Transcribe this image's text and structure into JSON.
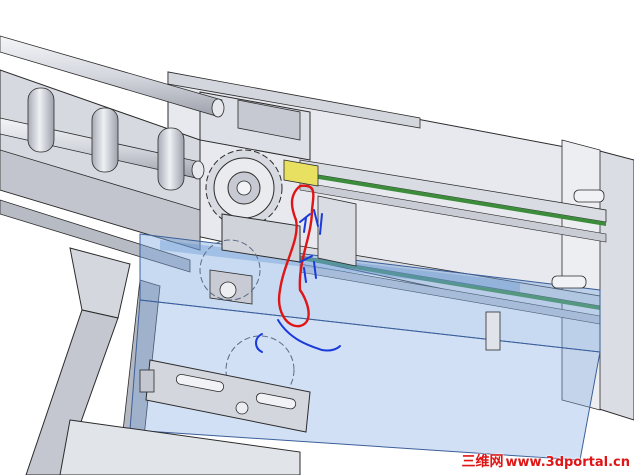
{
  "scene": {
    "description_type": "cad-viewport",
    "colors": {
      "background": "#ffffff",
      "metal_light": "#e4e6ec",
      "metal_mid": "#c9ccd4",
      "metal_dark": "#8a8e98",
      "outline": "#2b2b2b",
      "translucent_blue": "#7aa6e0",
      "green_rail": "#3c8c3c",
      "yellow_part": "#e8e060",
      "annotation_red": "#e01515",
      "annotation_blue": "#1a3adc"
    }
  },
  "annotations": {
    "red_marks": "red-outline-sketch",
    "blue_marks": "blue-handwritten-text"
  },
  "watermark": {
    "site_name": "三维网",
    "site_url": "www.3dportal.cn"
  }
}
